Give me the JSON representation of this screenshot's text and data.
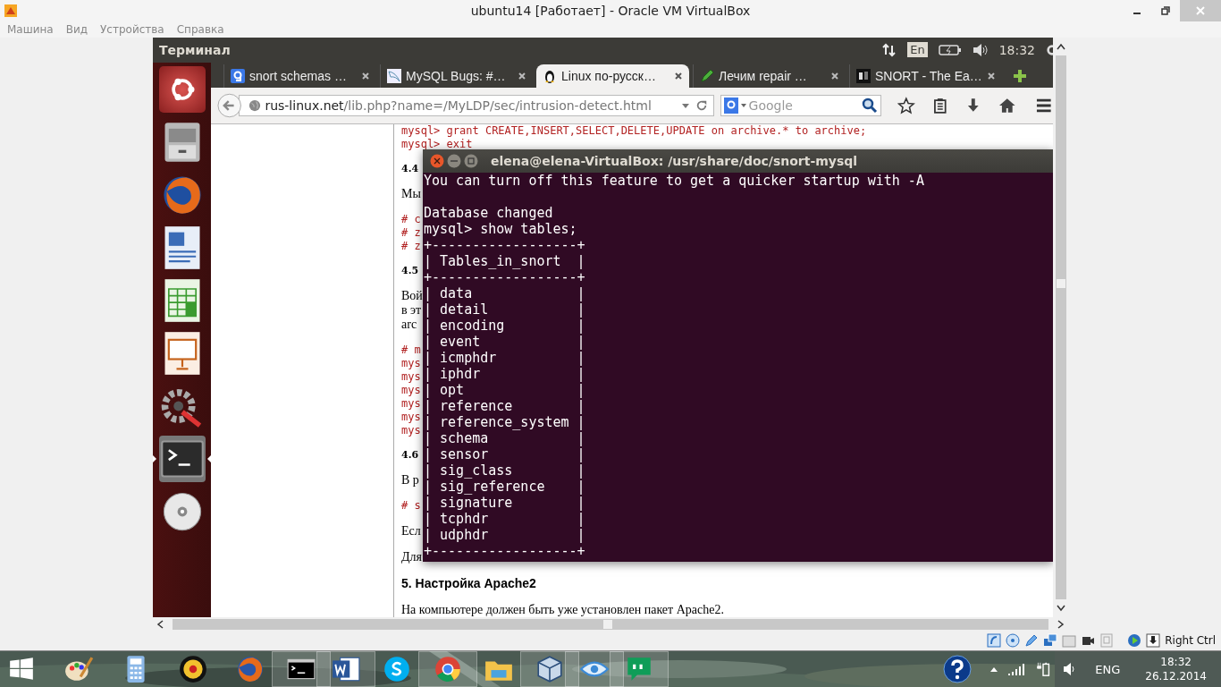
{
  "vbox": {
    "title": "ubuntu14 [Работает] - Oracle VM VirtualBox",
    "menu": [
      "Машина",
      "Вид",
      "Устройства",
      "Справка"
    ],
    "host_key": "Right Ctrl"
  },
  "panel": {
    "app_title": "Терминал",
    "keyboard": "En",
    "time": "18:32"
  },
  "browser": {
    "tabs": [
      {
        "title": "snort schemas …",
        "selected": false
      },
      {
        "title": "MySQL Bugs: #…",
        "selected": false
      },
      {
        "title": "Linux по-русск…",
        "selected": true
      },
      {
        "title": "Лечим repair …",
        "selected": false
      },
      {
        "title": "SNORT - The Ea…",
        "selected": false
      }
    ],
    "url_host": "rus-linux.net",
    "url_path": "/lib.php?name=/MyLDP/sec/intrusion-detect.html",
    "search_placeholder": "Google"
  },
  "page": {
    "blocks": [
      {
        "kind": "code",
        "lines": [
          "mysql> grant CREATE,INSERT,SELECT,DELETE,UPDATE on archive.* to archive;",
          "mysql> exit"
        ]
      },
      {
        "kind": "heading",
        "lines": [
          "4.4"
        ]
      },
      {
        "kind": "para",
        "lines": [
          "Мы"
        ]
      },
      {
        "kind": "code",
        "lines": [
          "# c",
          "# z",
          "# z"
        ]
      },
      {
        "kind": "heading",
        "lines": [
          "4.5"
        ]
      },
      {
        "kind": "para",
        "lines": [
          "Вой",
          "в эт",
          "arc"
        ]
      },
      {
        "kind": "code",
        "lines": [
          "# m",
          "mys",
          "mys",
          "mys",
          "mys",
          "mys",
          "mys"
        ]
      },
      {
        "kind": "heading",
        "lines": [
          "4.6"
        ]
      },
      {
        "kind": "para",
        "lines": [
          "В р"
        ]
      },
      {
        "kind": "code",
        "lines": [
          "# s"
        ]
      },
      {
        "kind": "para",
        "lines": [
          "Есл"
        ]
      },
      {
        "kind": "para",
        "lines": [
          "Для"
        ]
      },
      {
        "kind": "section",
        "lines": [
          "5. Настройка Apache2"
        ]
      },
      {
        "kind": "para",
        "lines": [
          "На компьютере должен быть уже установлен пакет Apache2."
        ]
      }
    ]
  },
  "terminal": {
    "title": "elena@elena-VirtualBox: /usr/share/doc/snort-mysql",
    "blocks": [
      [
        "You can turn off this feature to get a quicker startup with -A"
      ],
      [
        "Database changed",
        "mysql> show tables;",
        "+------------------+",
        "| Tables_in_snort  |",
        "+------------------+",
        "| data             |",
        "| detail           |",
        "| encoding         |",
        "| event            |",
        "| icmphdr          |",
        "| iphdr            |",
        "| opt              |",
        "| reference        |",
        "| reference_system |",
        "| schema           |",
        "| sensor           |",
        "| sig_class        |",
        "| sig_reference    |",
        "| signature        |",
        "| tcphdr           |",
        "| udphdr           |",
        "+------------------+"
      ]
    ]
  },
  "taskbar": {
    "lang": "ENG",
    "time": "18:32",
    "date": "26.12.2014"
  }
}
